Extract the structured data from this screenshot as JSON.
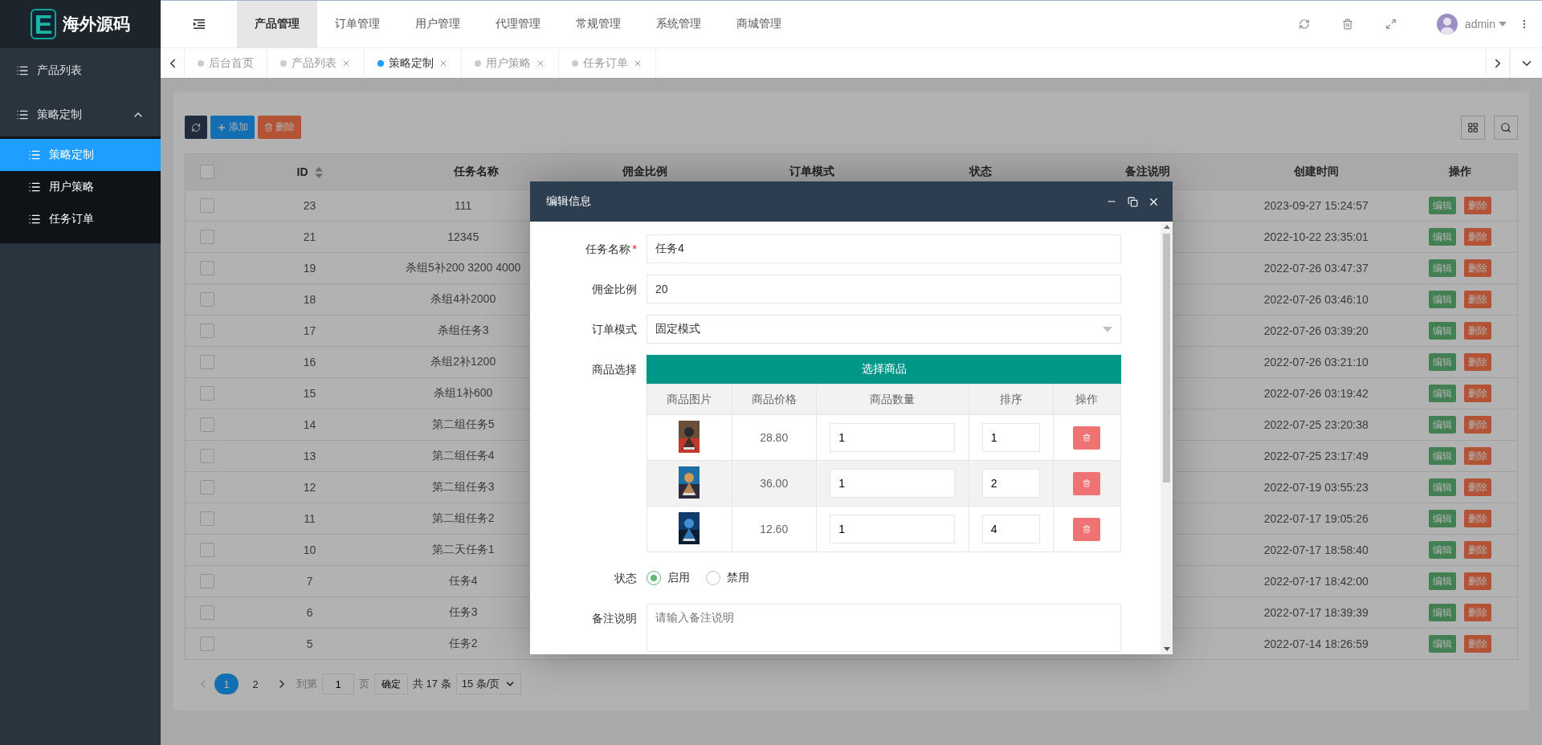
{
  "logo": {
    "letter": "E",
    "title": "海外源码"
  },
  "sidebar": {
    "items": [
      {
        "label": "产品列表",
        "selected": false
      },
      {
        "label": "策略定制",
        "selected": false,
        "expanded": true,
        "children": [
          {
            "label": "策略定制",
            "selected": true
          },
          {
            "label": "用户策略",
            "selected": false
          },
          {
            "label": "任务订单",
            "selected": false
          }
        ]
      }
    ]
  },
  "top_nav": [
    {
      "label": "产品管理",
      "selected": true
    },
    {
      "label": "订单管理",
      "selected": false
    },
    {
      "label": "用户管理",
      "selected": false
    },
    {
      "label": "代理管理",
      "selected": false
    },
    {
      "label": "常规管理",
      "selected": false
    },
    {
      "label": "系统管理",
      "selected": false
    },
    {
      "label": "商城管理",
      "selected": false
    }
  ],
  "user": {
    "name": "admin"
  },
  "tabs": [
    {
      "label": "后台首页",
      "selected": false,
      "closable": false
    },
    {
      "label": "产品列表",
      "selected": false,
      "closable": true
    },
    {
      "label": "策略定制",
      "selected": true,
      "closable": true
    },
    {
      "label": "用户策略",
      "selected": false,
      "closable": true
    },
    {
      "label": "任务订单",
      "selected": false,
      "closable": true
    }
  ],
  "toolbar": {
    "add": "添加",
    "delete": "删除"
  },
  "table": {
    "select_all_checked": false,
    "columns": [
      "ID",
      "任务名称",
      "佣金比例",
      "订单模式",
      "状态",
      "备注说明",
      "创建时间",
      "操作"
    ],
    "rows": [
      {
        "id": "23",
        "checked": false,
        "name": "111",
        "created": "2023-09-27 15:24:57",
        "actions": [
          "编辑",
          "删除"
        ]
      },
      {
        "id": "21",
        "checked": false,
        "name": "12345",
        "created": "2022-10-22 23:35:01",
        "actions": [
          "编辑",
          "删除"
        ]
      },
      {
        "id": "19",
        "checked": false,
        "name": "杀组5补200 3200 4000",
        "created": "2022-07-26 03:47:37",
        "actions": [
          "编辑",
          "删除"
        ]
      },
      {
        "id": "18",
        "checked": false,
        "name": "杀组4补2000",
        "created": "2022-07-26 03:46:10",
        "actions": [
          "编辑",
          "删除"
        ]
      },
      {
        "id": "17",
        "checked": false,
        "name": "杀组任务3",
        "created": "2022-07-26 03:39:20",
        "actions": [
          "编辑",
          "删除"
        ]
      },
      {
        "id": "16",
        "checked": false,
        "name": "杀组2补1200",
        "created": "2022-07-26 03:21:10",
        "actions": [
          "编辑",
          "删除"
        ]
      },
      {
        "id": "15",
        "checked": false,
        "name": "杀组1补600",
        "created": "2022-07-26 03:19:42",
        "actions": [
          "编辑",
          "删除"
        ]
      },
      {
        "id": "14",
        "checked": false,
        "name": "第二组任务5",
        "created": "2022-07-25 23:20:38",
        "actions": [
          "编辑",
          "删除"
        ]
      },
      {
        "id": "13",
        "checked": false,
        "name": "第二组任务4",
        "created": "2022-07-25 23:17:49",
        "actions": [
          "编辑",
          "删除"
        ]
      },
      {
        "id": "12",
        "checked": false,
        "name": "第二组任务3",
        "created": "2022-07-19 03:55:23",
        "actions": [
          "编辑",
          "删除"
        ]
      },
      {
        "id": "11",
        "checked": false,
        "name": "第二组任务2",
        "created": "2022-07-17 19:05:26",
        "actions": [
          "编辑",
          "删除"
        ]
      },
      {
        "id": "10",
        "checked": false,
        "name": "第二天任务1",
        "created": "2022-07-17 18:58:40",
        "actions": [
          "编辑",
          "删除"
        ]
      },
      {
        "id": "7",
        "checked": false,
        "name": "任务4",
        "created": "2022-07-17 18:42:00",
        "actions": [
          "编辑",
          "删除"
        ]
      },
      {
        "id": "6",
        "checked": false,
        "name": "任务3",
        "created": "2022-07-17 18:39:39",
        "actions": [
          "编辑",
          "删除"
        ]
      },
      {
        "id": "5",
        "checked": false,
        "name": "任务2",
        "created": "2022-07-14 18:26:59",
        "actions": [
          "编辑",
          "删除"
        ]
      }
    ]
  },
  "pagination": {
    "pages": [
      {
        "label": "1",
        "selected": true
      },
      {
        "label": "2",
        "selected": false
      }
    ],
    "goto_label": "到第",
    "page_input": "1",
    "page_unit": "页",
    "confirm": "确定",
    "total": "共 17 条",
    "page_size": "15 条/页"
  },
  "modal": {
    "title": "编辑信息",
    "fields": [
      {
        "kind": "text",
        "label": "任务名称",
        "required_mark": "*",
        "value": "任务4"
      },
      {
        "kind": "text",
        "label": "佣金比例",
        "value": "20"
      },
      {
        "kind": "select",
        "label": "订单模式",
        "value": "固定模式"
      },
      {
        "kind": "goods",
        "label": "商品选择",
        "button": "选择商品",
        "columns": [
          "商品图片",
          "商品价格",
          "商品数量",
          "排序",
          "操作"
        ],
        "rows": [
          {
            "price": "28.80",
            "quantity": "1",
            "order": "1"
          },
          {
            "price": "36.00",
            "quantity": "1",
            "order": "2"
          },
          {
            "price": "12.60",
            "quantity": "1",
            "order": "4"
          }
        ]
      },
      {
        "kind": "radio",
        "label": "状态",
        "options": [
          {
            "label": "启用",
            "selected": true
          },
          {
            "label": "禁用",
            "selected": false
          }
        ]
      },
      {
        "kind": "textarea",
        "label": "备注说明",
        "placeholder": "请输入备注说明"
      }
    ]
  }
}
